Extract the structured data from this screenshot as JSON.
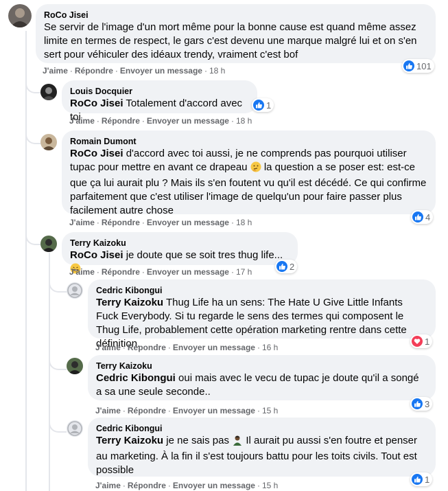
{
  "comments": [
    {
      "author": "RoCo Jisei",
      "text": "Se servir de l'image d'un mort même pour la bonne cause est quand même assez limite en termes de respect, le gars c'est devenu une marque malgré lui et on s'en sert pour véhiculer des idéaux trendy, vraiment c'est bof",
      "time": "18 h",
      "reaction_count": "101",
      "reaction_type": "like",
      "replies": [
        {
          "author": "Louis Docquier",
          "mention": "RoCo Jisei",
          "text": " Totalement d'accord avec toi",
          "time": "18 h",
          "reaction_count": "1",
          "reaction_type": "like"
        },
        {
          "author": "Romain Dumont",
          "mention": "RoCo Jisei",
          "text_part1": " d'accord avec toi aussi, je ne comprends pas pourquoi utiliser tupac pour mettre en avant ce drapeau ",
          "emoji": "thinking-face-emoji",
          "text_part2": " la question a se poser est: est-ce que ça lui aurait plu ? Mais ils s'en foutent vu qu'il est décédé. Ce qui confirme parfaitement que c'est utiliser l'image de quelqu'un pour faire passer plus facilement autre chose",
          "time": "18 h",
          "reaction_count": "4",
          "reaction_type": "like"
        },
        {
          "author": "Terry Kaizoku",
          "mention": "RoCo Jisei",
          "text": " je doute que se soit tres thug life... ",
          "emoji": "grinning-emoji",
          "time": "17 h",
          "reaction_count": "2",
          "reaction_type": "like",
          "replies": [
            {
              "author": "Cedric Kibongui",
              "mention": "Terry Kaizoku",
              "text": " Thug Life ha un sens: The Hate U Give Little Infants Fuck Everybody. Si tu regarde le sens des termes qui composent le Thug Life, probablement cette opération marketing rentre dans cette définition.",
              "time": "16 h",
              "reaction_count": "1",
              "reaction_type": "love"
            },
            {
              "author": "Terry Kaizoku",
              "mention": "Cedric Kibongui",
              "text": " oui mais avec le vecu de tupac je doute qu'il a songé a sa une seule seconde..",
              "time": "15 h",
              "reaction_count": "3",
              "reaction_type": "like"
            },
            {
              "author": "Cedric Kibongui",
              "mention": "Terry Kaizoku",
              "text_part1": " je ne sais pas ",
              "emoji": "person-emoji",
              "text_part2": " Il aurait pu aussi s'en foutre et penser au marketing. À la fin il s'est toujours battu pour les toits civils. Tout est possible",
              "time": "15 h",
              "reaction_count": "1",
              "reaction_type": "like"
            }
          ]
        }
      ]
    }
  ],
  "actions": {
    "like": "J'aime",
    "reply": "Répondre",
    "message": "Envoyer un message",
    "separator": "·"
  },
  "icons": {
    "like": "thumbs-up-icon",
    "love": "heart-icon"
  },
  "colors": {
    "like": "#1877f2",
    "love": "#f33e58",
    "bubble": "#f0f2f5",
    "meta_text": "#65676b"
  }
}
